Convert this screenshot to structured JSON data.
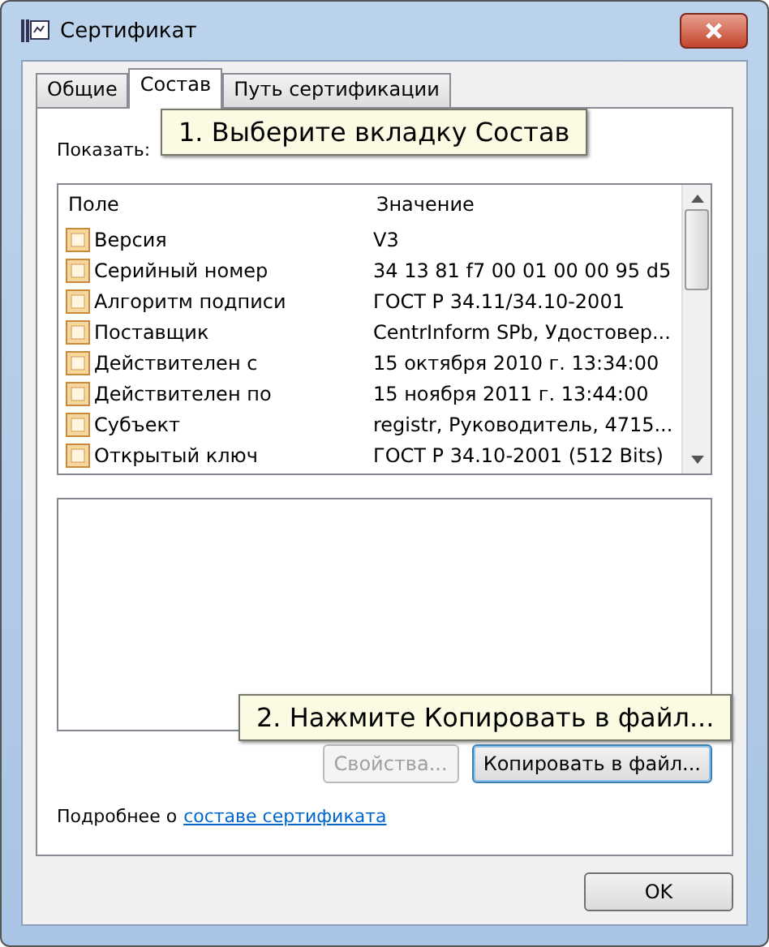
{
  "window": {
    "title": "Сертификат"
  },
  "tabs": [
    {
      "label": "Общие",
      "selected": false
    },
    {
      "label": "Состав",
      "selected": true
    },
    {
      "label": "Путь сертификации",
      "selected": false
    }
  ],
  "show_label": "Показать:",
  "table": {
    "columns": [
      "Поле",
      "Значение"
    ],
    "rows": [
      {
        "field": "Версия",
        "value": "V3"
      },
      {
        "field": "Серийный номер",
        "value": "34 13 81 f7 00 01 00 00 95 d5"
      },
      {
        "field": "Алгоритм подписи",
        "value": "ГОСТ Р 34.11/34.10-2001"
      },
      {
        "field": "Поставщик",
        "value": "CentrInform SPb, Удостовер..."
      },
      {
        "field": "Действителен с",
        "value": "15 октября 2010 г. 13:34:00"
      },
      {
        "field": "Действителен по",
        "value": "15 ноября 2011 г. 13:44:00"
      },
      {
        "field": "Субъект",
        "value": "registr, Руководитель, 4715..."
      },
      {
        "field": "Открытый ключ",
        "value": "ГОСТ Р 34.10-2001 (512 Bits)"
      }
    ]
  },
  "buttons": [
    {
      "label": "Свойства...",
      "disabled": true
    },
    {
      "label": "Копировать в файл...",
      "disabled": false
    }
  ],
  "more_text": "Подробнее о",
  "more_link": "составе сертификата",
  "ok_button": "OK",
  "callouts": [
    "1. Выберите вкладку Состав",
    "2. Нажмите Копировать в файл..."
  ]
}
